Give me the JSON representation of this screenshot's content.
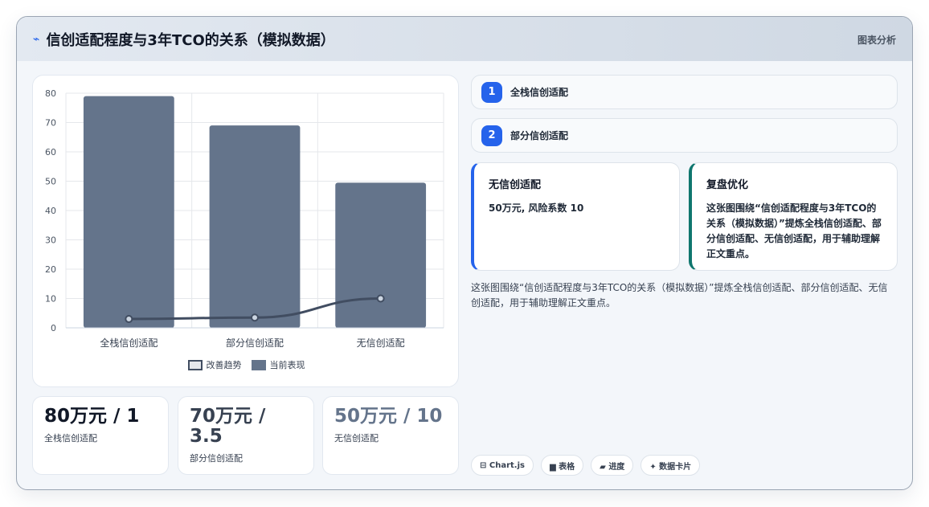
{
  "header": {
    "icon": "⌁",
    "title": "信创适配程度与3年TCO的关系（模拟数据）",
    "tag": "图表分析"
  },
  "chart_data": {
    "type": "bar",
    "categories": [
      "全栈信创适配",
      "部分信创适配",
      "无信创适配"
    ],
    "series": [
      {
        "name": "当前表现",
        "type": "bar",
        "values": [
          79,
          69,
          49.5
        ],
        "color": "#64748b"
      },
      {
        "name": "改善趋势",
        "type": "line",
        "values": [
          3,
          3.5,
          10
        ],
        "color": "#414d61"
      }
    ],
    "ylim": [
      0,
      80
    ],
    "yticks": [
      0,
      10,
      20,
      30,
      40,
      50,
      60,
      70,
      80
    ],
    "grid": true,
    "legend": "bottom"
  },
  "legend": {
    "line_label": "改善趋势",
    "bar_label": "当前表现"
  },
  "kpis": [
    {
      "value": "80万元 / 1",
      "label": "全栈信创适配",
      "color": "#111827"
    },
    {
      "value": "70万元 / 3.5",
      "label": "部分信创适配",
      "color": "#374151"
    },
    {
      "value": "50万元 / 10",
      "label": "无信创适配",
      "color": "#64748b"
    }
  ],
  "steps": [
    {
      "num": "1",
      "label": "全栈信创适配"
    },
    {
      "num": "2",
      "label": "部分信创适配"
    }
  ],
  "info_box": {
    "title": "无信创适配",
    "body": "50万元, 风险系数 10"
  },
  "review_box": {
    "title": "复盘优化",
    "body": "这张图围绕“信创适配程度与3年TCO的关系（模拟数据）”提炼全栈信创适配、部分信创适配、无信创适配，用于辅助理解正文重点。"
  },
  "summary": "这张图围绕“信创适配程度与3年TCO的关系（模拟数据）”提炼全栈信创适配、部分信创适配、无信创适配，用于辅助理解正文重点。",
  "chips": [
    "⊟ Chart.js",
    "▆ 表格",
    "▰ 进度",
    "✦ 数据卡片"
  ]
}
